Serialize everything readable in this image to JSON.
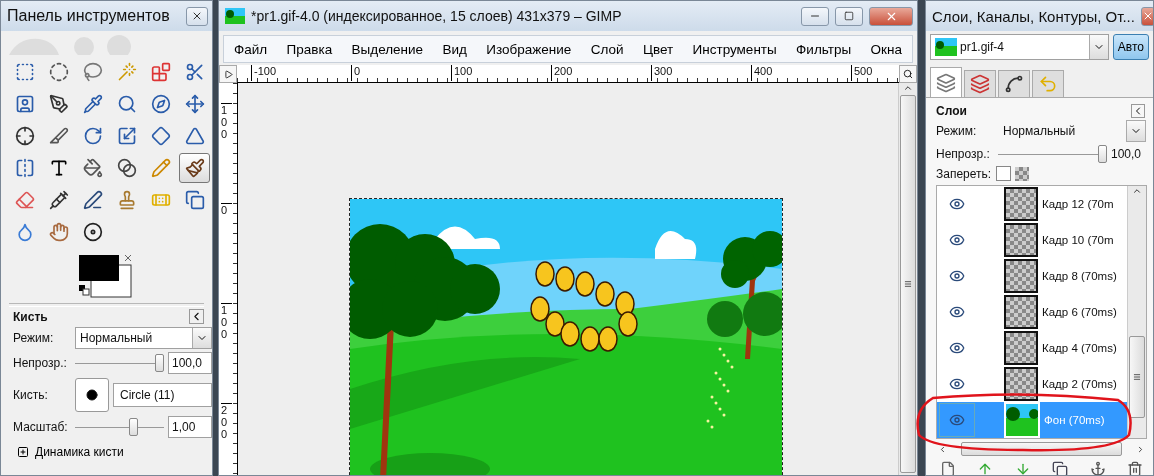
{
  "toolbox": {
    "title": "Панель инструментов",
    "tools": [
      {
        "selected": false
      },
      {
        "selected": false
      },
      {
        "selected": false
      },
      {
        "selected": false
      },
      {
        "selected": false
      },
      {
        "selected": false
      },
      {
        "selected": false
      },
      {
        "selected": false
      },
      {
        "selected": false
      },
      {
        "selected": false
      },
      {
        "selected": false
      },
      {
        "selected": false
      },
      {
        "selected": false
      },
      {
        "selected": false
      },
      {
        "selected": false
      },
      {
        "selected": false
      },
      {
        "selected": false
      },
      {
        "selected": false
      },
      {
        "selected": false
      },
      {
        "selected": false
      },
      {
        "selected": false
      },
      {
        "selected": false
      },
      {
        "selected": false
      },
      {
        "selected": true
      },
      {
        "selected": false
      },
      {
        "selected": false
      },
      {
        "selected": false
      },
      {
        "selected": false
      },
      {
        "selected": false
      },
      {
        "selected": false
      },
      {
        "selected": false
      },
      {
        "selected": false
      },
      {
        "selected": false
      }
    ],
    "tool_options": {
      "title": "Кисть",
      "mode_label": "Режим:",
      "mode": "Нормальный",
      "opacity_label": "Непрозр.:",
      "opacity": {
        "level": 1,
        "reading": "100,0"
      },
      "brush_label": "Кисть:",
      "brush": "Circle (11)",
      "scale_label": "Масштаб:",
      "scale": {
        "level": 0.68,
        "reading": "1,00"
      },
      "dynamics": {
        "label": "Динамика кисти",
        "expanded": false
      }
    }
  },
  "image_window": {
    "title": "*pr1.gif-4.0 (индексированное, 15 слоев) 431x379 – GIMP",
    "menu": [
      "Файл",
      "Правка",
      "Выделение",
      "Вид",
      "Изображение",
      "Слой",
      "Цвет",
      "Инструменты",
      "Фильтры",
      "Окна"
    ],
    "ruler_labels": [
      "-100",
      "0",
      "100",
      "200",
      "300",
      "400",
      "500"
    ],
    "vertical_ruler_labels": [
      "100",
      "0",
      "100",
      "200"
    ]
  },
  "layers_dock": {
    "title": "Слои, Каналы, Контуры, От...",
    "image": "pr1.gif-4",
    "auto_button": "Авто",
    "tabs": [
      {
        "selected": true
      },
      {
        "selected": false
      },
      {
        "selected": false
      },
      {
        "selected": false
      }
    ],
    "section_title": "Слои",
    "mode_label": "Режим:",
    "mode": "Нормальный",
    "opacity_label": "Непрозр.:",
    "opacity": {
      "level": 1,
      "reading": "100,0"
    },
    "lock_label": "Запереть:",
    "lock_pixels": {
      "checked": false
    },
    "layers": [
      {
        "name": "Кадр 12 (70m",
        "kind": "frame",
        "visible": true,
        "selected": false
      },
      {
        "name": "Кадр 10 (70m",
        "kind": "frame",
        "visible": true,
        "selected": false
      },
      {
        "name": "Кадр 8 (70ms)",
        "kind": "frame",
        "visible": true,
        "selected": false
      },
      {
        "name": "Кадр 6 (70ms)",
        "kind": "frame",
        "visible": true,
        "selected": false
      },
      {
        "name": "Кадр 4 (70ms)",
        "kind": "frame",
        "visible": true,
        "selected": false
      },
      {
        "name": "Кадр 2 (70ms)",
        "kind": "frame",
        "visible": true,
        "selected": false
      },
      {
        "name": "Фон (70ms)",
        "kind": "background",
        "visible": true,
        "selected": true
      }
    ]
  }
}
